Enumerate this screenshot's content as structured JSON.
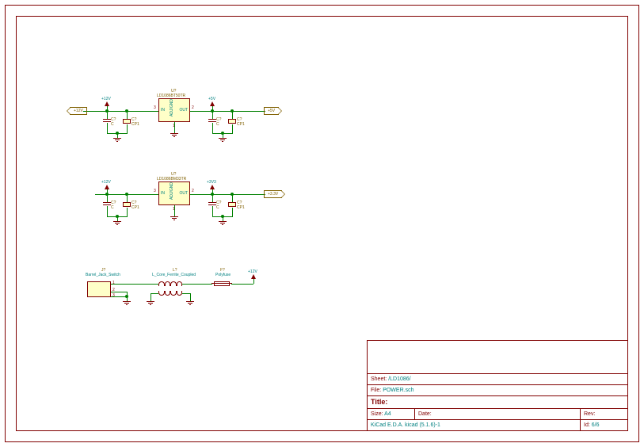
{
  "title_block": {
    "sheet_label": "Sheet:",
    "sheet_value": "/LD1086/",
    "file_label": "File:",
    "file_value": "POWER.sch",
    "title_label": "Title:",
    "size_label": "Size:",
    "size_value": "A4",
    "date_label": "Date:",
    "rev_label": "Rev:",
    "tool_value": "KiCad E.D.A.  kicad (5.1.6)-1",
    "id_label": "Id:",
    "id_value": "6/6"
  },
  "reg1": {
    "ref": "U?",
    "part": "LD1086BT50TR",
    "pin_in": "IN",
    "pin_out": "OUT",
    "pin_adj": "ADJ/GND",
    "pn_in": "3",
    "pn_out": "2",
    "pn_adj": "1",
    "in_pwr": "+12V",
    "out_pwr": "+5V",
    "net_in": "+12V",
    "net_out": "+5V"
  },
  "reg2": {
    "ref": "U?",
    "part": "LD1086BM33TR",
    "pin_in": "IN",
    "pin_out": "OUT",
    "pin_adj": "ADJ/GND",
    "pn_in": "3",
    "pn_out": "2",
    "pn_adj": "1",
    "in_pwr": "+12V",
    "out_pwr": "+3V3",
    "net_out": "+3.3V"
  },
  "cap": {
    "ref": "C?",
    "val": "C",
    "pref": "C?",
    "pval": "CP1"
  },
  "jack": {
    "ref": "J?",
    "part": "Barrel_Jack_Switch",
    "p1": "1",
    "p2": "2",
    "p3": "3"
  },
  "ind": {
    "ref": "L?",
    "part": "L_Core_Ferrite_Coupled"
  },
  "fuse": {
    "ref": "F?",
    "part": "Polyfuse"
  },
  "out12": "+12V",
  "gnd": "GND"
}
